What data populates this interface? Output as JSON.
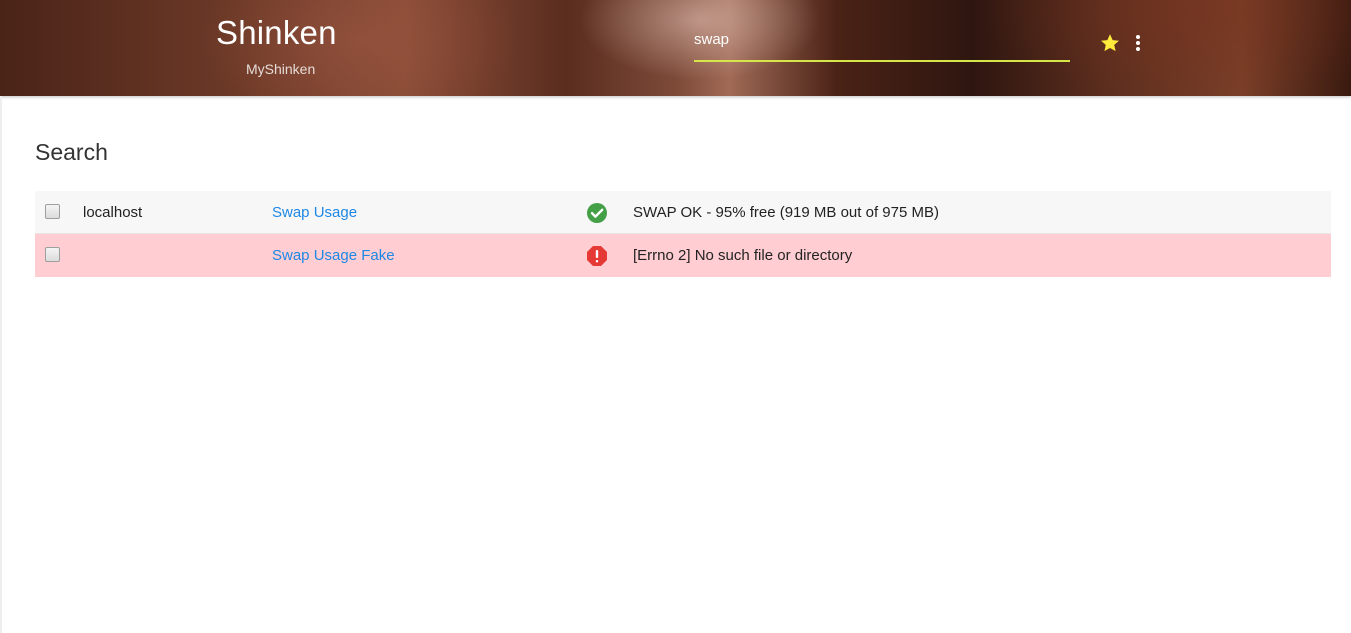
{
  "brand": {
    "title": "Shinken",
    "subtitle": "MyShinken"
  },
  "search": {
    "value": "swap"
  },
  "page_title": "Search",
  "colors": {
    "accent_underline": "#d6e64a",
    "link": "#1e88e5",
    "ok": "#43a047",
    "critical": "#e53935",
    "critical_row": "#ffcdd2",
    "star": "#ffeb3b"
  },
  "results": [
    {
      "host": "localhost",
      "service": "Swap Usage",
      "state": "ok",
      "state_icon": "check-circle-icon",
      "output": "SWAP OK - 95% free (919 MB out of 975 MB)"
    },
    {
      "host": "",
      "service": "Swap Usage Fake",
      "state": "critical",
      "state_icon": "alert-octagon-icon",
      "output": "[Errno 2] No such file or directory"
    }
  ]
}
